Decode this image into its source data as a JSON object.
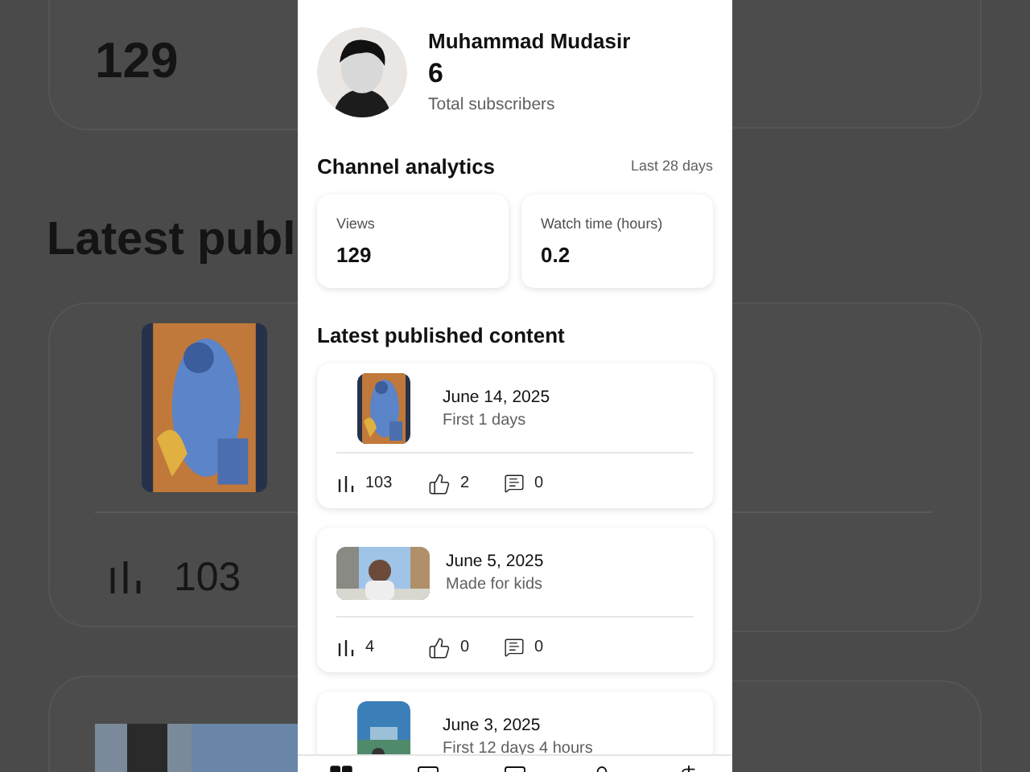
{
  "backdrop": {
    "views_value": "129",
    "section_title": "Latest publ",
    "views_count": "103"
  },
  "profile": {
    "name": "Muhammad Mudasir",
    "subscribers": "6",
    "subscribers_label": "Total subscribers"
  },
  "analytics": {
    "title": "Channel analytics",
    "period": "Last 28 days",
    "metrics": [
      {
        "label": "Views",
        "value": "129"
      },
      {
        "label": "Watch time (hours)",
        "value": "0.2"
      }
    ]
  },
  "latest": {
    "title": "Latest published content",
    "items": [
      {
        "kind": "portrait",
        "date": "June 14, 2025",
        "note": "First 1 days",
        "views": "103",
        "likes": "2",
        "comments": "0"
      },
      {
        "kind": "landscape",
        "date": "June 5, 2025",
        "note": "Made for kids",
        "views": "4",
        "likes": "0",
        "comments": "0"
      },
      {
        "kind": "portrait",
        "date": "June 3, 2025",
        "note": "First 12 days 4 hours"
      }
    ]
  },
  "nav": [
    {
      "selected": true
    },
    {
      "selected": false
    },
    {
      "selected": false
    },
    {
      "selected": false
    },
    {
      "selected": false
    }
  ]
}
